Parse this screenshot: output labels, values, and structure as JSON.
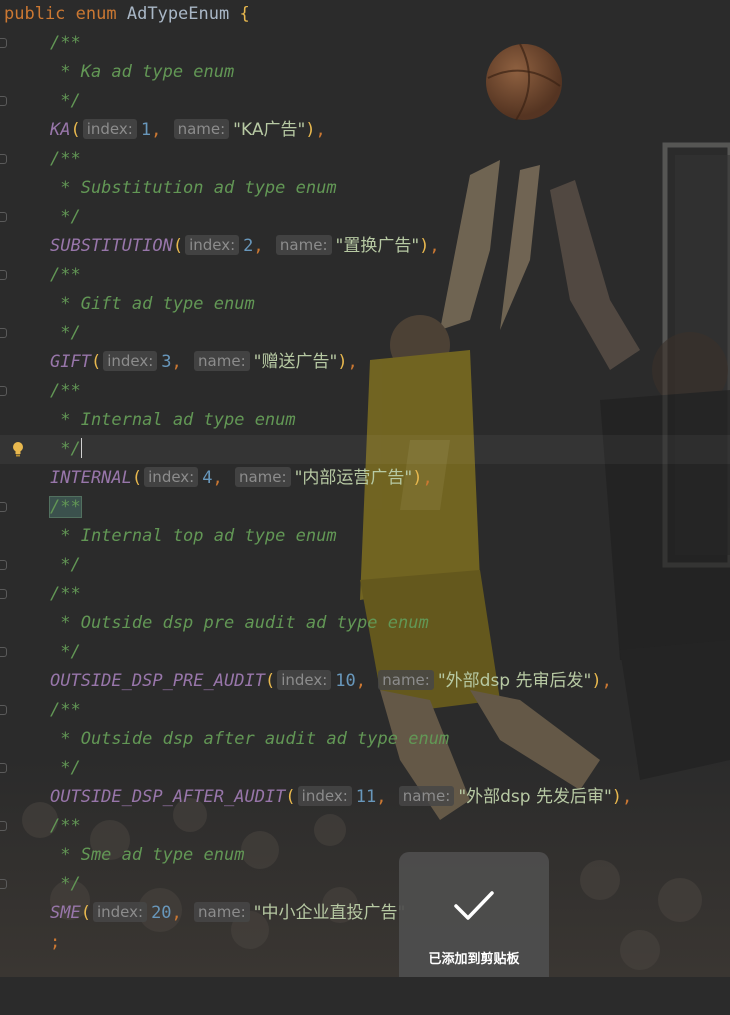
{
  "header": {
    "public": "public",
    "enum": "enum",
    "name": "AdTypeEnum",
    "brace": "{"
  },
  "labels": {
    "index": "index:",
    "name": "name:"
  },
  "ka": {
    "doc_open": "/**",
    "doc": " * Ka ad type enum",
    "doc_close": " */",
    "constant": "KA",
    "index": "1",
    "name": "\"KA广告\""
  },
  "substitution": {
    "doc_open": "/**",
    "doc": " * Substitution ad type enum",
    "doc_close": " */",
    "constant": "SUBSTITUTION",
    "index": "2",
    "name": "\"置换广告\""
  },
  "gift": {
    "doc_open": "/**",
    "doc": " * Gift ad type enum",
    "doc_close": " */",
    "constant": "GIFT",
    "index": "3",
    "name": "\"赠送广告\""
  },
  "internal": {
    "doc_open": "/**",
    "doc": " * Internal ad type enum",
    "doc_close": " */",
    "constant": "INTERNAL",
    "index": "4",
    "name": "\"内部运营广告\""
  },
  "internal_top": {
    "doc_open": "/**",
    "doc": " * Internal top ad type enum",
    "doc_close": " */"
  },
  "outside_pre": {
    "doc_open": "/**",
    "doc": " * Outside dsp pre audit ad type enum",
    "doc_close": " */",
    "constant": "OUTSIDE_DSP_PRE_AUDIT",
    "index": "10",
    "name": "\"外部dsp 先审后发\""
  },
  "outside_after": {
    "doc_open": "/**",
    "doc": " * Outside dsp after audit ad type enum",
    "doc_close": " */",
    "constant": "OUTSIDE_DSP_AFTER_AUDIT",
    "index": "11",
    "name": "\"外部dsp 先发后审\""
  },
  "sme": {
    "doc_open": "/**",
    "doc": " * Sme ad type enum",
    "doc_close": " */",
    "constant": "SME",
    "index": "20",
    "name": "\"中小企业直投广告\""
  },
  "semicolon": ";",
  "toast": {
    "text": "已添加到剪贴板",
    "icon": "checkmark-icon"
  },
  "colors": {
    "keyword": "#cc7832",
    "doc_comment": "#629755",
    "enum_constant": "#9876aa",
    "number": "#6897bb",
    "string": "#6a8759",
    "brace": "#e8b84e",
    "background": "#2b2b2b"
  }
}
